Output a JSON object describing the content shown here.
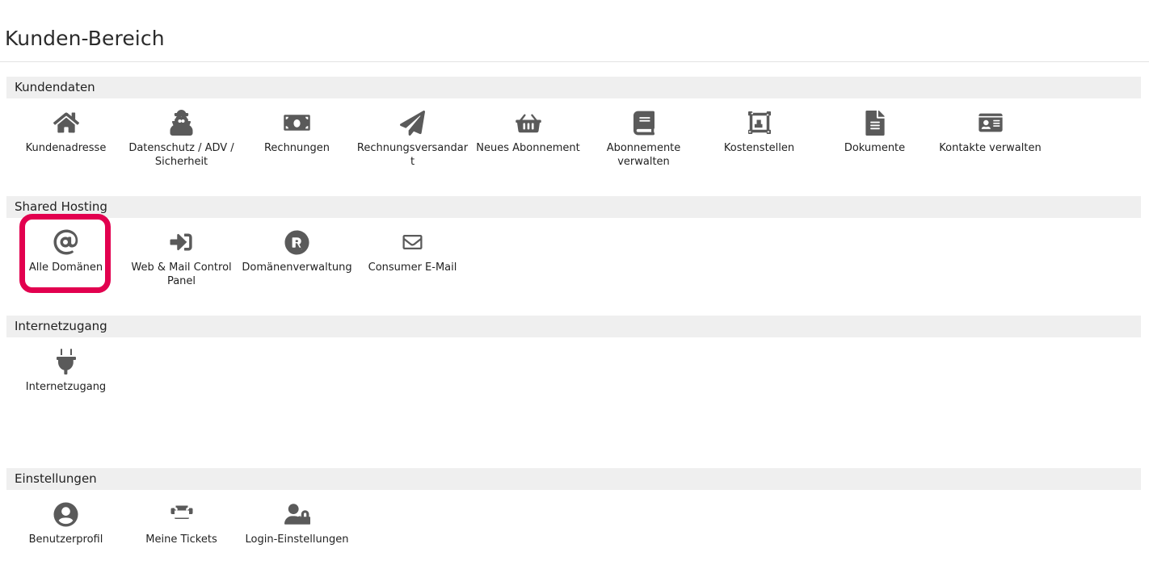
{
  "page": {
    "title": "Kunden-Bereich",
    "accent_highlight_color": "#e2004f",
    "section_header_bg": "#efefef",
    "icon_color": "#5a5a5a",
    "text_color": "#222222"
  },
  "sections": [
    {
      "title": "Kundendaten",
      "tiles": [
        {
          "label": "Kundenadresse",
          "icon": "home-icon"
        },
        {
          "label": "Datenschutz / ADV / Sicherheit",
          "icon": "user-secret-icon"
        },
        {
          "label": "Rechnungen",
          "icon": "money-bill-icon"
        },
        {
          "label": "Rechnungsversandart",
          "icon": "paper-plane-icon"
        },
        {
          "label": "Neues Abonnement",
          "icon": "shopping-basket-icon"
        },
        {
          "label": "Abonnemente verwalten",
          "icon": "book-icon"
        },
        {
          "label": "Kostenstellen",
          "icon": "object-group-icon"
        },
        {
          "label": "Dokumente",
          "icon": "file-alt-icon"
        },
        {
          "label": "Kontakte verwalten",
          "icon": "id-card-icon"
        }
      ]
    },
    {
      "title": "Shared Hosting",
      "tiles": [
        {
          "label": "Alle Domänen",
          "icon": "at-icon",
          "highlighted": true
        },
        {
          "label": "Web & Mail Control Panel",
          "icon": "sign-in-icon"
        },
        {
          "label": "Domänenverwaltung",
          "icon": "registered-icon"
        },
        {
          "label": "Consumer E-Mail",
          "icon": "envelope-icon"
        }
      ]
    },
    {
      "title": "Internetzugang",
      "tiles": [
        {
          "label": "Internetzugang",
          "icon": "plug-icon"
        }
      ]
    },
    {
      "title": "Einstellungen",
      "tiles": [
        {
          "label": "Benutzerprofil",
          "icon": "user-circle-icon"
        },
        {
          "label": "Meine Tickets",
          "icon": "ticket-icon"
        },
        {
          "label": "Login-Einstellungen",
          "icon": "user-lock-icon"
        }
      ]
    }
  ]
}
